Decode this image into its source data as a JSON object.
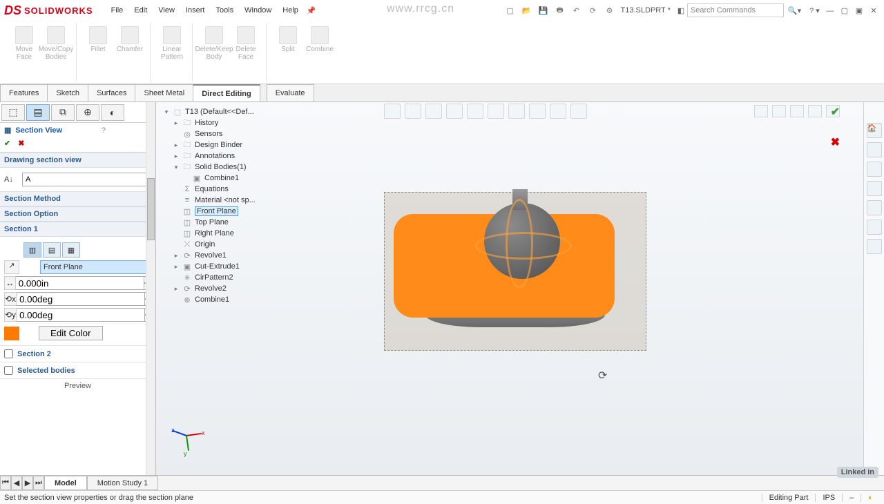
{
  "app": {
    "brand": "SOLIDWORKS",
    "doc": "T13.SLDPRT *"
  },
  "watermark_url": "www.rrcg.cn",
  "menu": {
    "file": "File",
    "edit": "Edit",
    "view": "View",
    "insert": "Insert",
    "tools": "Tools",
    "window": "Window",
    "help": "Help"
  },
  "search_placeholder": "Search Commands",
  "ribbon": {
    "move_face": "Move\nFace",
    "move_copy": "Move/Copy\nBodies",
    "fillet": "Fillet",
    "chamfer": "Chamfer",
    "linear_pattern": "Linear\nPattern",
    "delete_keep": "Delete/Keep\nBody",
    "delete_face": "Delete\nFace",
    "split": "Split",
    "combine": "Combine"
  },
  "tabs": {
    "features": "Features",
    "sketch": "Sketch",
    "surfaces": "Surfaces",
    "sheetmetal": "Sheet Metal",
    "direct": "Direct Editing",
    "evaluate": "Evaluate"
  },
  "panel": {
    "title": "Section View",
    "drawing_header": "Drawing section view",
    "drawing_value": "A",
    "method": "Section Method",
    "option": "Section Option",
    "section1": "Section 1",
    "plane": "Front Plane",
    "offset": "0.000in",
    "ang1": "0.00deg",
    "ang2": "0.00deg",
    "edit_color": "Edit Color",
    "section2": "Section 2",
    "selected_bodies": "Selected bodies",
    "preview": "Preview"
  },
  "tree": {
    "root": "T13  (Default<<Def...",
    "history": "History",
    "sensors": "Sensors",
    "design_binder": "Design Binder",
    "annotations": "Annotations",
    "solid_bodies": "Solid Bodies(1)",
    "combine1_body": "Combine1",
    "equations": "Equations",
    "material": "Material  <not sp...",
    "front": "Front Plane",
    "top": "Top Plane",
    "right": "Right Plane",
    "origin": "Origin",
    "revolve1": "Revolve1",
    "cut_extrude1": "Cut-Extrude1",
    "cirpattern2": "CirPattern2",
    "revolve2": "Revolve2",
    "combine1": "Combine1"
  },
  "bottom": {
    "model": "Model",
    "motion": "Motion Study 1"
  },
  "status": {
    "msg": "Set the section view properties or drag the section plane",
    "mode": "Editing Part",
    "units": "IPS"
  },
  "linkedin": "Linked in"
}
